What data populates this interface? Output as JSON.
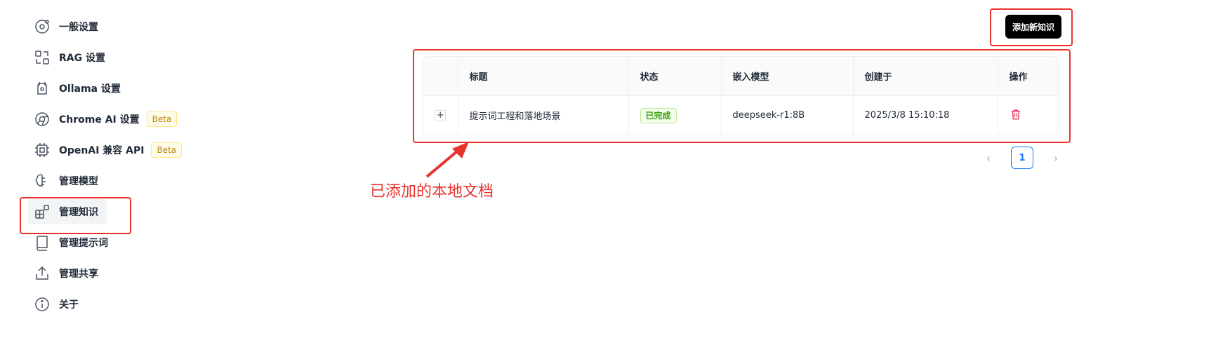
{
  "sidebar": {
    "items": [
      {
        "label": "一般设置",
        "icon": "orbit-icon"
      },
      {
        "label": "RAG 设置",
        "icon": "rag-icon"
      },
      {
        "label": "Ollama 设置",
        "icon": "llama-icon"
      },
      {
        "label": "Chrome AI 设置",
        "icon": "chrome-icon",
        "badge": "Beta"
      },
      {
        "label": "OpenAI 兼容 API",
        "icon": "chip-icon",
        "badge": "Beta"
      },
      {
        "label": "管理模型",
        "icon": "brain-icon"
      },
      {
        "label": "管理知识",
        "icon": "blocks-icon",
        "active": true
      },
      {
        "label": "管理提示词",
        "icon": "book-icon"
      },
      {
        "label": "管理共享",
        "icon": "share-icon"
      },
      {
        "label": "关于",
        "icon": "info-icon"
      }
    ]
  },
  "toolbar": {
    "add_label": "添加新知识"
  },
  "table": {
    "headers": [
      "",
      "标题",
      "状态",
      "嵌入模型",
      "创建于",
      "操作"
    ],
    "rows": [
      {
        "expand": "+",
        "title": "提示词工程和落地场景",
        "status": "已完成",
        "model": "deepseek-r1:8B",
        "created": "2025/3/8 15:10:18"
      }
    ]
  },
  "pagination": {
    "prev": "‹",
    "current": "1",
    "next": "›"
  },
  "annotation": {
    "text": "已添加的本地文档"
  },
  "colors": {
    "highlight": "#e8332d",
    "accent": "#1677ff",
    "success": "#389e0d",
    "danger": "#e11d48"
  }
}
